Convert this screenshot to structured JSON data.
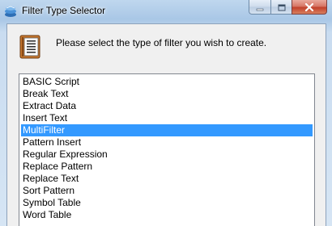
{
  "window": {
    "title": "Filter Type Selector"
  },
  "icons": {
    "app": "filter-app-icon",
    "header": "filter-document-icon",
    "minimize": "minimize-icon",
    "maximize": "maximize-icon",
    "close": "close-icon"
  },
  "prompt": "Please select the type of filter you wish to create.",
  "filter_list": {
    "selected": "MultiFilter",
    "items": [
      "BASIC Script",
      "Break Text",
      "Extract Data",
      "Insert Text",
      "MultiFilter",
      "Pattern Insert",
      "Regular Expression",
      "Replace Pattern",
      "Replace Text",
      "Sort Pattern",
      "Symbol Table",
      "Word Table"
    ]
  },
  "colors": {
    "selection": "#3399ff",
    "close_button": "#c2412b",
    "client_bg": "#f0f0f0"
  }
}
